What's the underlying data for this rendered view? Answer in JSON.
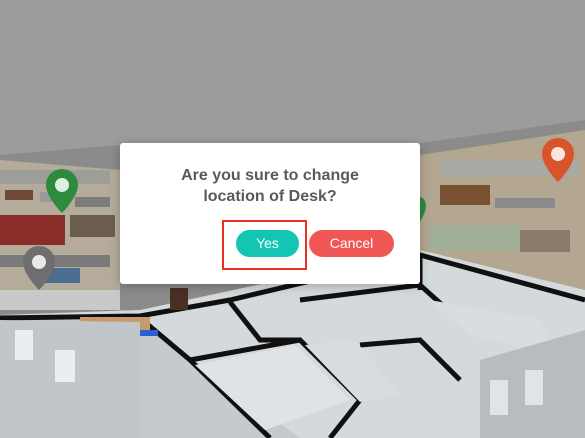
{
  "dialog": {
    "message": "Are you sure to change\nlocation of Desk?",
    "yes_label": "Yes",
    "cancel_label": "Cancel"
  },
  "map_markers": [
    {
      "name": "green-location-pin",
      "color": "#2e8b3e"
    },
    {
      "name": "gray-location-pin",
      "color": "#6e6e6e"
    },
    {
      "name": "orange-location-pin",
      "color": "#d9542a"
    },
    {
      "name": "green-location-pin-partial",
      "color": "#2e8b3e"
    }
  ],
  "colors": {
    "overlay": "#9c9c9c",
    "yes_button": "#13c6b3",
    "cancel_button": "#f05754",
    "highlight_border": "#e8321f"
  }
}
